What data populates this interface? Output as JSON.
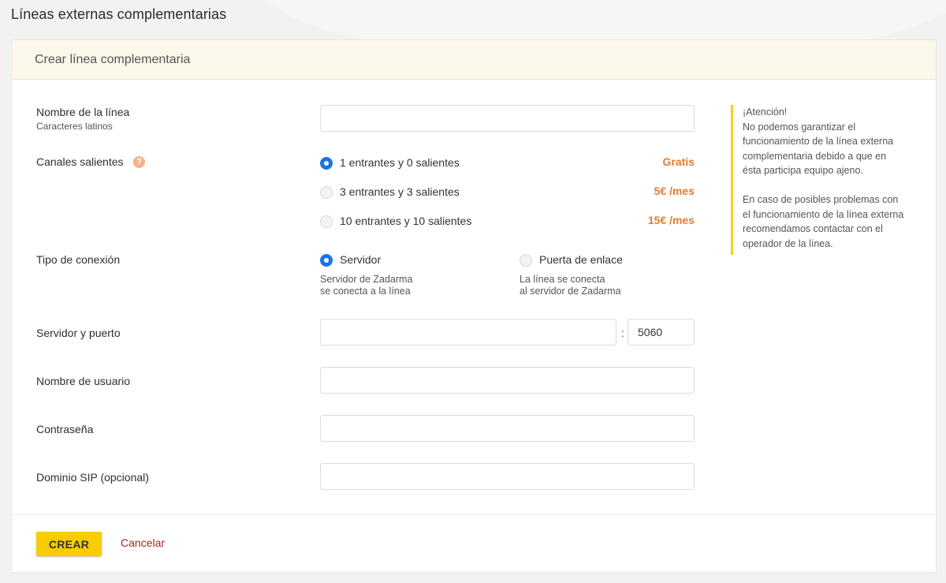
{
  "page": {
    "title": "Líneas externas complementarias"
  },
  "card": {
    "header": "Crear línea complementaria"
  },
  "form": {
    "line_name": {
      "label": "Nombre de la línea",
      "hint": "Caracteres latinos",
      "value": ""
    },
    "channels": {
      "label": "Canales salientes",
      "help": "?",
      "options": [
        {
          "label": "1 entrantes y 0 salientes",
          "price": "Gratis",
          "checked": true
        },
        {
          "label": "3 entrantes y 3 salientes",
          "price": "5€ /mes",
          "checked": false
        },
        {
          "label": "10 entrantes y 10 salientes",
          "price": "15€ /mes",
          "checked": false
        }
      ]
    },
    "connection": {
      "label": "Tipo de conexión",
      "options": [
        {
          "label": "Servidor",
          "desc1": "Servidor de Zadarma",
          "desc2": "se conecta a la línea",
          "checked": true
        },
        {
          "label": "Puerta de enlace",
          "desc1": "La línea se conecta",
          "desc2": "al servidor de Zadarma",
          "checked": false
        }
      ]
    },
    "server": {
      "label": "Servidor y puerto",
      "host_value": "",
      "separator": ":",
      "port_value": "5060"
    },
    "username": {
      "label": "Nombre de usuario",
      "value": ""
    },
    "password": {
      "label": "Contraseña",
      "value": ""
    },
    "sip_domain": {
      "label": "Dominio SIP (opcional)",
      "value": ""
    }
  },
  "notice": {
    "title": "¡Atención!",
    "text1": "No podemos garantizar el funcionamiento de la línea externa complementaria debido a que en ésta participa equipo ajeno.",
    "text2": "En caso de posibles problemas con el funcionamiento de la línea externa recomendamos contactar con el operador de la línea.",
    "accent_color": "#f5cf1f"
  },
  "actions": {
    "create": "CREAR",
    "cancel": "Cancelar"
  },
  "colors": {
    "primary_button": "#f7cc00",
    "radio_checked": "#1a73e8",
    "price": "#e57c2f",
    "cancel_link": "#9b2a1f"
  }
}
